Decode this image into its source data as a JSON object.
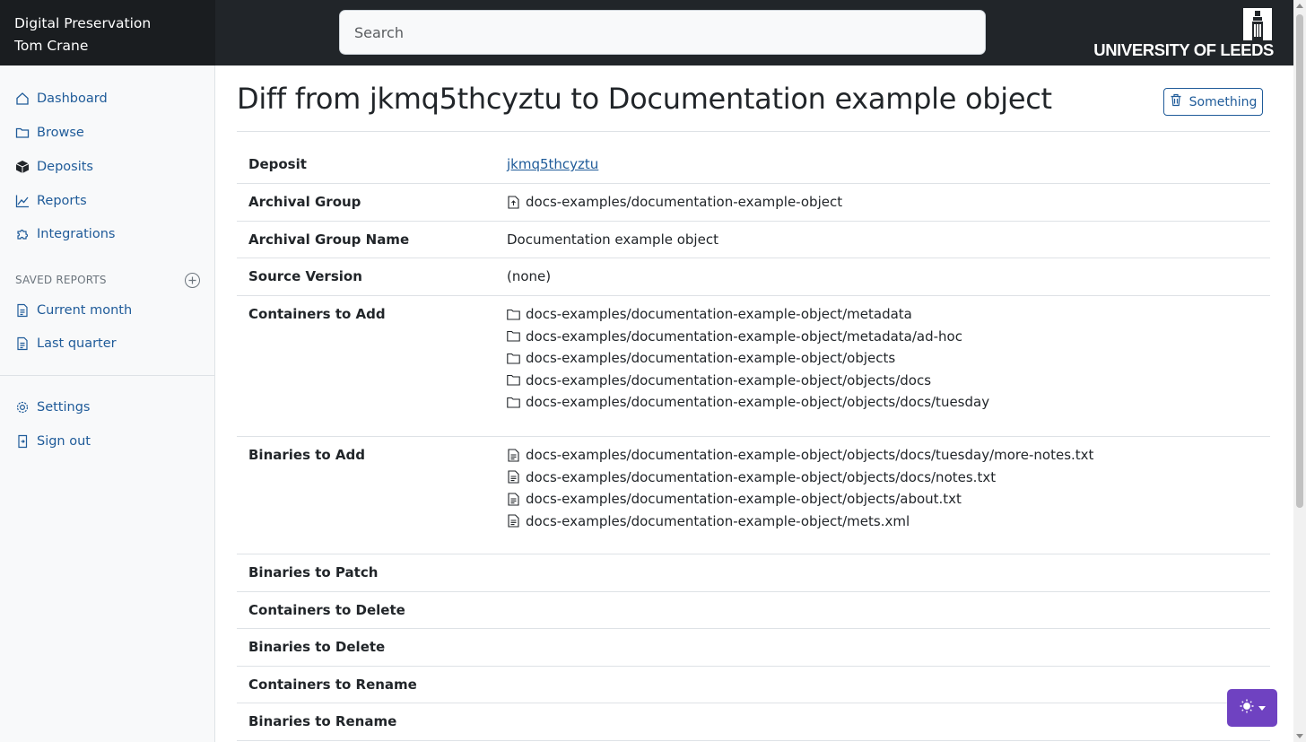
{
  "header": {
    "app_title": "Digital Preservation",
    "user_name": "Tom Crane",
    "search_placeholder": "Search",
    "logo_text": "UNIVERSITY OF LEEDS"
  },
  "sidebar": {
    "items": [
      {
        "label": "Dashboard",
        "icon": "house-icon"
      },
      {
        "label": "Browse",
        "icon": "folder-icon"
      },
      {
        "label": "Deposits",
        "icon": "box-icon"
      },
      {
        "label": "Reports",
        "icon": "line-chart-icon"
      },
      {
        "label": "Integrations",
        "icon": "puzzle-icon"
      }
    ],
    "saved_reports_heading": "SAVED REPORTS",
    "saved_reports": [
      {
        "label": "Current month",
        "icon": "document-icon"
      },
      {
        "label": "Last quarter",
        "icon": "document-icon"
      }
    ],
    "bottom_items": [
      {
        "label": "Settings",
        "icon": "gear-icon"
      },
      {
        "label": "Sign out",
        "icon": "sign-out-icon"
      }
    ]
  },
  "main": {
    "title": "Diff from jkmq5thcyztu to Documentation example object",
    "action_button": "Something",
    "rows": {
      "deposit": {
        "label": "Deposit",
        "value": "jkmq5thcyztu"
      },
      "archival_group": {
        "label": "Archival Group",
        "value": "docs-examples/documentation-example-object"
      },
      "archival_group_name": {
        "label": "Archival Group Name",
        "value": "Documentation example object"
      },
      "source_version": {
        "label": "Source Version",
        "value": "(none)"
      },
      "containers_to_add": {
        "label": "Containers to Add",
        "items": [
          "docs-examples/documentation-example-object/metadata",
          "docs-examples/documentation-example-object/metadata/ad-hoc",
          "docs-examples/documentation-example-object/objects",
          "docs-examples/documentation-example-object/objects/docs",
          "docs-examples/documentation-example-object/objects/docs/tuesday"
        ]
      },
      "binaries_to_add": {
        "label": "Binaries to Add",
        "items": [
          "docs-examples/documentation-example-object/objects/docs/tuesday/more-notes.txt",
          "docs-examples/documentation-example-object/objects/docs/notes.txt",
          "docs-examples/documentation-example-object/objects/about.txt",
          "docs-examples/documentation-example-object/mets.xml"
        ]
      },
      "binaries_to_patch": {
        "label": "Binaries to Patch"
      },
      "containers_to_delete": {
        "label": "Containers to Delete"
      },
      "binaries_to_delete": {
        "label": "Binaries to Delete"
      },
      "containers_to_rename": {
        "label": "Containers to Rename"
      },
      "binaries_to_rename": {
        "label": "Binaries to Rename"
      }
    }
  },
  "theme_toggle": {
    "icon": "sun-icon"
  },
  "colors": {
    "link": "#1f5b99",
    "topbar": "#212529",
    "theme_button": "#6f42c1"
  }
}
